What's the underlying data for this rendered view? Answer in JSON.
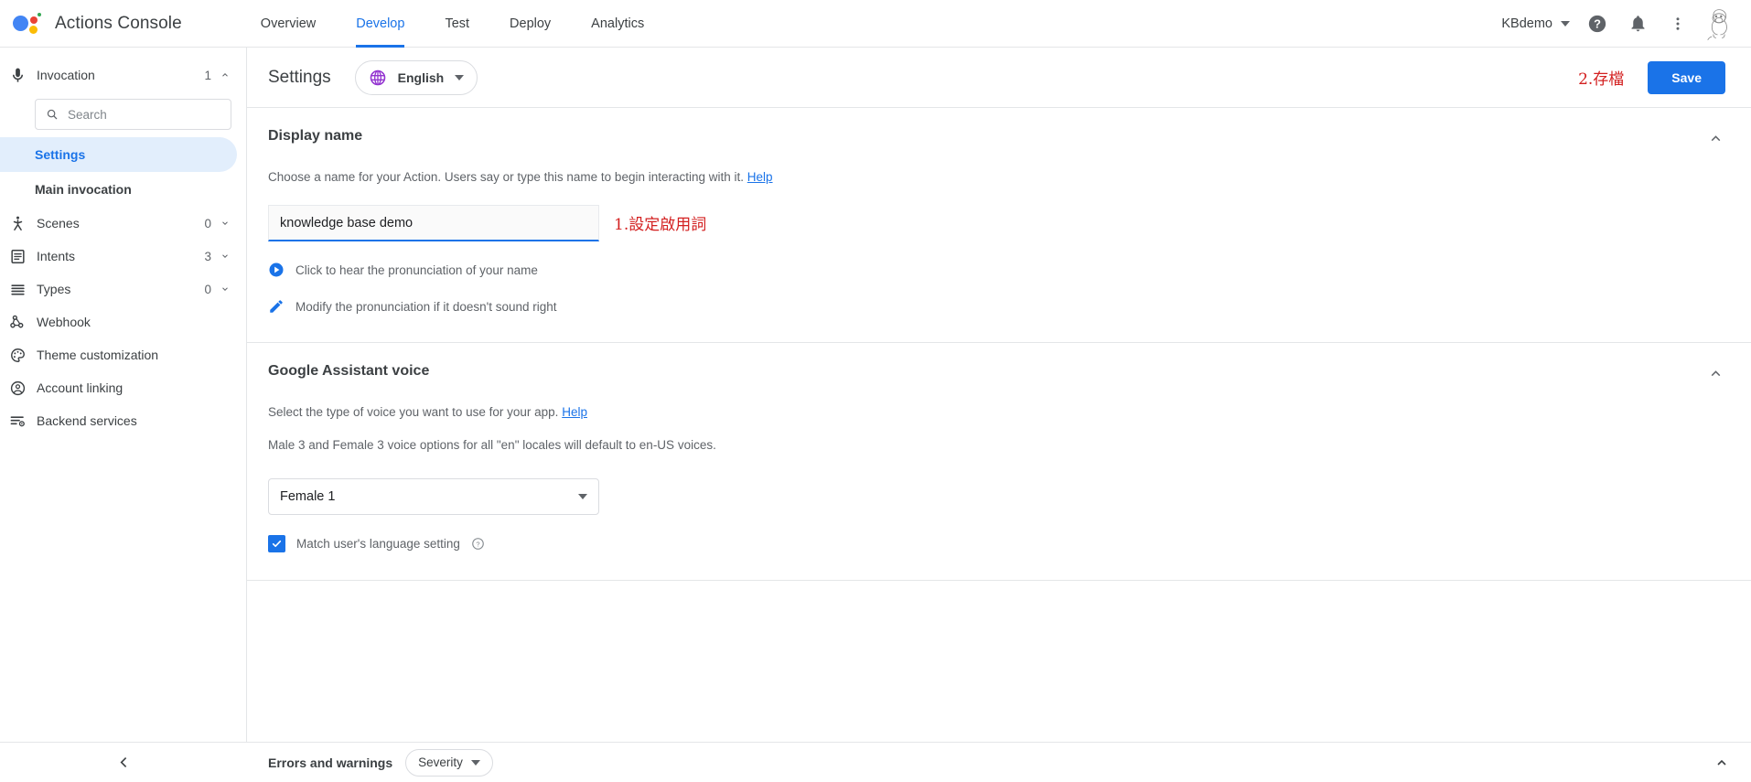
{
  "topbar": {
    "logo_icon": "google-assistant-logo",
    "app_title": "Actions Console",
    "tabs": [
      {
        "label": "Overview",
        "active": false
      },
      {
        "label": "Develop",
        "active": true
      },
      {
        "label": "Test",
        "active": false
      },
      {
        "label": "Deploy",
        "active": false
      },
      {
        "label": "Analytics",
        "active": false
      }
    ],
    "project_name": "KBdemo",
    "help_icon": "help-circle-icon",
    "notifications_icon": "bell-icon",
    "more_icon": "more-vertical-icon",
    "avatar_icon": "user-avatar-moomin"
  },
  "sidebar": {
    "invocation": {
      "label": "Invocation",
      "count": "1",
      "icon": "microphone-icon",
      "expanded": true
    },
    "search": {
      "placeholder": "Search",
      "value": "",
      "icon": "search-icon"
    },
    "sub_items": [
      {
        "label": "Settings",
        "selected": true
      },
      {
        "label": "Main invocation",
        "selected": false
      }
    ],
    "items": [
      {
        "label": "Scenes",
        "count": "0",
        "icon": "scenes-icon",
        "has_chevron": true
      },
      {
        "label": "Intents",
        "count": "3",
        "icon": "intents-icon",
        "has_chevron": true
      },
      {
        "label": "Types",
        "count": "0",
        "icon": "types-icon",
        "has_chevron": true
      },
      {
        "label": "Webhook",
        "count": "",
        "icon": "webhook-icon",
        "has_chevron": false
      },
      {
        "label": "Theme customization",
        "count": "",
        "icon": "palette-icon",
        "has_chevron": false
      },
      {
        "label": "Account linking",
        "count": "",
        "icon": "account-circle-icon",
        "has_chevron": false
      },
      {
        "label": "Backend services",
        "count": "",
        "icon": "backend-services-icon",
        "has_chevron": false
      }
    ],
    "collapse_icon": "chevron-left-icon"
  },
  "main_header": {
    "title": "Settings",
    "language": {
      "label": "English",
      "icon": "globe-icon",
      "icon_color": "#9334d0"
    },
    "annotation": "2.存檔",
    "annotation_color": "#d32020",
    "save_label": "Save",
    "save_color": "#1a73e8"
  },
  "display_name_section": {
    "title": "Display name",
    "description": "Choose a name for your Action. Users say or type this name to begin interacting with it.",
    "help_link": "Help",
    "input_value": "knowledge base demo",
    "annotation": "1.設定啟用詞",
    "play_line": "Click to hear the pronunciation of your name",
    "play_icon": "play-circle-icon",
    "edit_line": "Modify the pronunciation if it doesn't sound right",
    "edit_icon": "pencil-icon",
    "collapse_icon": "chevron-up-icon"
  },
  "voice_section": {
    "title": "Google Assistant voice",
    "description": "Select the type of voice you want to use for your app.",
    "help_link": "Help",
    "note": "Male 3 and Female 3 voice options for all \"en\" locales will default to en-US voices.",
    "selected_voice": "Female 1",
    "checkbox_label": "Match user's language setting",
    "checkbox_checked": true,
    "info_icon": "help-circle-outline-icon",
    "collapse_icon": "chevron-up-icon"
  },
  "bottombar": {
    "title": "Errors and warnings",
    "severity_label": "Severity",
    "expand_icon": "chevron-up-icon"
  }
}
